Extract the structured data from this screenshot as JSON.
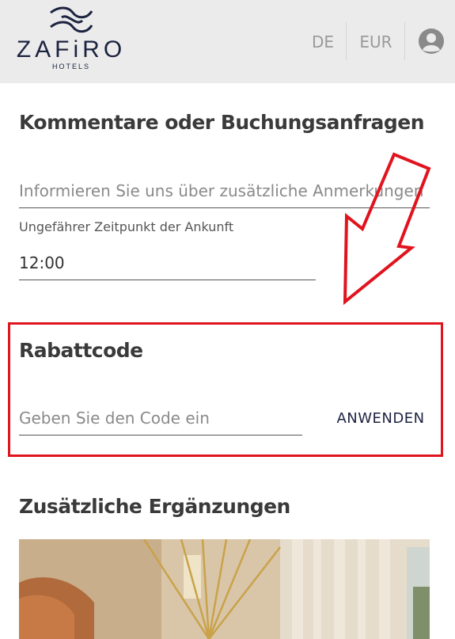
{
  "header": {
    "logo_word": "ZAFiRO",
    "logo_sub": "HOTELS",
    "language": "DE",
    "currency": "EUR",
    "account_icon": "user-circle-icon"
  },
  "comments": {
    "title": "Kommentare oder Buchungsanfragen",
    "notes_placeholder": "Informieren Sie uns über zusätzliche Anmerkungen",
    "arrival_label": "Ungefährer Zeitpunkt der Ankunft",
    "arrival_value": "12:00"
  },
  "discount": {
    "title": "Rabattcode",
    "code_placeholder": "Geben Sie den Code ein",
    "apply_label": "ANWENDEN"
  },
  "extras": {
    "title": "Zusätzliche Ergänzungen"
  },
  "colors": {
    "header_bg": "#ebebeb",
    "brand": "#1c2340",
    "highlight": "#e0141e"
  }
}
